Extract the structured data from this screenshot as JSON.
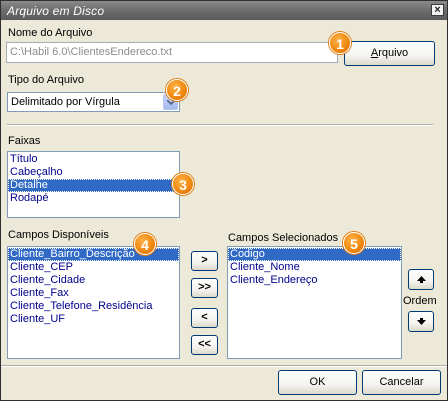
{
  "window": {
    "title": "Arquivo em Disco"
  },
  "file": {
    "label": "Nome do Arquivo",
    "path": "C:\\Habil 6.0\\ClientesEndereco.txt",
    "browse_button": "Arquivo"
  },
  "file_type": {
    "label": "Tipo do Arquivo",
    "selected": "Delimitado por Vírgula"
  },
  "faixas": {
    "label": "Faixas",
    "items": [
      "Título",
      "Cabeçalho",
      "Detalhe",
      "Rodapé"
    ]
  },
  "available": {
    "label": "Campos Disponíveis",
    "items": [
      "Cliente_Bairro_Descrição",
      "Cliente_CEP",
      "Cliente_Cidade",
      "Cliente_Fax",
      "Cliente_Telefone_Residência",
      "Cliente_UF"
    ]
  },
  "selected": {
    "label": "Campos Selecionados",
    "items": [
      "Codigo",
      "Cliente_Nome",
      "Cliente_Endereço"
    ]
  },
  "move_buttons": {
    "add": ">",
    "add_all": ">>",
    "remove": "<",
    "remove_all": "<<"
  },
  "order": {
    "label": "Ordem"
  },
  "footer": {
    "ok": "OK",
    "cancel": "Cancelar"
  },
  "badges": [
    "1",
    "2",
    "3",
    "4",
    "5"
  ],
  "colors": {
    "badge": "#f08a10",
    "selection": "#316ac5",
    "list_text": "#00008b"
  }
}
